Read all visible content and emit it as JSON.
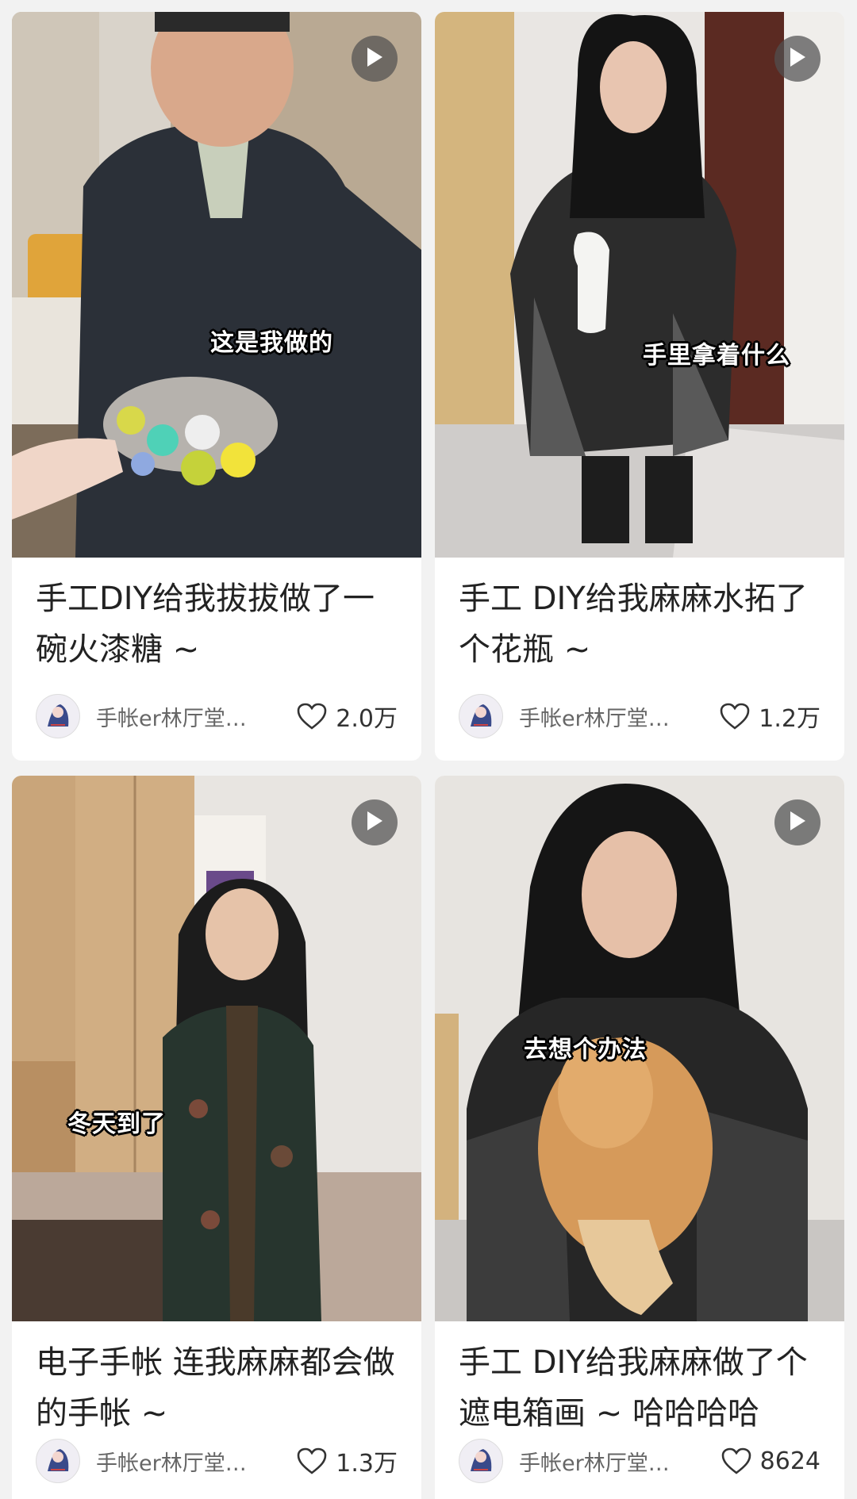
{
  "cards": [
    {
      "title": "手工DIY给我拔拔做了一碗火漆糖 ~",
      "caption": "这是我做的",
      "author": "手帐er林厅堂…",
      "likes": "2.0万"
    },
    {
      "title": "手工 DIY给我麻麻水拓了个花瓶 ~",
      "caption": "手里拿着什么",
      "author": "手帐er林厅堂…",
      "likes": "1.2万"
    },
    {
      "title": "电子手帐 连我麻麻都会做的手帐 ~",
      "caption": "冬天到了",
      "author": "手帐er林厅堂…",
      "likes": "1.3万"
    },
    {
      "title": "手工 DIY给我麻麻做了个遮电箱画 ~ 哈哈哈哈",
      "caption": "去想个办法",
      "author": "手帐er林厅堂…",
      "likes": "8624"
    }
  ],
  "icons": {
    "play": "play-icon",
    "like": "heart-outline-icon",
    "avatar": "author-avatar"
  },
  "colors": {
    "background": "#f2f2f2",
    "card": "#ffffff",
    "title_text": "#222222",
    "meta_text": "#666666"
  }
}
